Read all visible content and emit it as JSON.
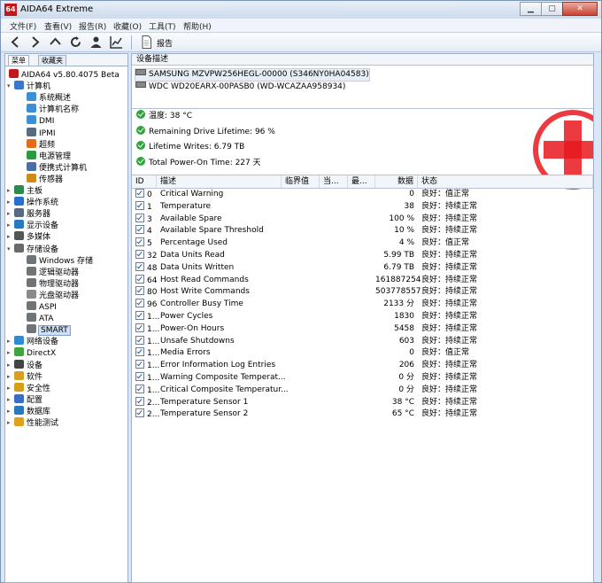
{
  "window": {
    "title": "AIDA64 Extreme",
    "app_icon_text": "64",
    "buttons": {
      "minimize": "▁",
      "maximize": "▢",
      "close": "✕"
    }
  },
  "menu": [
    "文件(F)",
    "查看(V)",
    "报告(R)",
    "收藏(O)",
    "工具(T)",
    "帮助(H)"
  ],
  "toolbar": {
    "icons": [
      "back-icon",
      "forward-icon",
      "up-icon",
      "refresh-icon",
      "user-icon",
      "chart-icon"
    ],
    "report_label": "报告"
  },
  "left_tabs": [
    "菜单",
    "收藏夹"
  ],
  "tree": [
    {
      "label": "AIDA64 v5.80.4075 Beta",
      "level": 0,
      "icon": "aida-icon",
      "expander": ""
    },
    {
      "label": "计算机",
      "level": 1,
      "icon": "computer-icon",
      "expander": "▾"
    },
    {
      "label": "系统概述",
      "level": 2,
      "icon": "monitor-icon",
      "expander": ""
    },
    {
      "label": "计算机名称",
      "level": 2,
      "icon": "monitor-icon",
      "expander": ""
    },
    {
      "label": "DMI",
      "level": 2,
      "icon": "monitor-icon",
      "expander": ""
    },
    {
      "label": "IPMI",
      "level": 2,
      "icon": "server-icon",
      "expander": ""
    },
    {
      "label": "超频",
      "level": 2,
      "icon": "flame-icon",
      "expander": ""
    },
    {
      "label": "电源管理",
      "level": 2,
      "icon": "power-icon",
      "expander": ""
    },
    {
      "label": "便携式计算机",
      "level": 2,
      "icon": "laptop-icon",
      "expander": ""
    },
    {
      "label": "传感器",
      "level": 2,
      "icon": "gauge-icon",
      "expander": ""
    },
    {
      "label": "主板",
      "level": 1,
      "icon": "motherboard-icon",
      "expander": "▸"
    },
    {
      "label": "操作系统",
      "level": 1,
      "icon": "windows-icon",
      "expander": "▸"
    },
    {
      "label": "服务器",
      "level": 1,
      "icon": "server-icon",
      "expander": "▸"
    },
    {
      "label": "显示设备",
      "level": 1,
      "icon": "display-icon",
      "expander": "▸"
    },
    {
      "label": "多媒体",
      "level": 1,
      "icon": "speaker-icon",
      "expander": "▸"
    },
    {
      "label": "存储设备",
      "level": 1,
      "icon": "storage-icon",
      "expander": "▾"
    },
    {
      "label": "Windows 存储",
      "level": 2,
      "icon": "drive-icon",
      "expander": ""
    },
    {
      "label": "逻辑驱动器",
      "level": 2,
      "icon": "drive-icon",
      "expander": ""
    },
    {
      "label": "物理驱动器",
      "level": 2,
      "icon": "drive-icon",
      "expander": ""
    },
    {
      "label": "光盘驱动器",
      "level": 2,
      "icon": "optical-icon",
      "expander": ""
    },
    {
      "label": "ASPI",
      "level": 2,
      "icon": "drive-icon",
      "expander": ""
    },
    {
      "label": "ATA",
      "level": 2,
      "icon": "drive-icon",
      "expander": ""
    },
    {
      "label": "SMART",
      "level": 2,
      "icon": "drive-icon",
      "expander": "",
      "selected": true
    },
    {
      "label": "网络设备",
      "level": 1,
      "icon": "network-icon",
      "expander": "▸"
    },
    {
      "label": "DirectX",
      "level": 1,
      "icon": "xbox-icon",
      "expander": "▸"
    },
    {
      "label": "设备",
      "level": 1,
      "icon": "device-icon",
      "expander": "▸"
    },
    {
      "label": "软件",
      "level": 1,
      "icon": "software-icon",
      "expander": "▸"
    },
    {
      "label": "安全性",
      "level": 1,
      "icon": "shield-icon",
      "expander": "▸"
    },
    {
      "label": "配置",
      "level": 1,
      "icon": "config-icon",
      "expander": "▸"
    },
    {
      "label": "数据库",
      "level": 1,
      "icon": "database-icon",
      "expander": "▸"
    },
    {
      "label": "性能测试",
      "level": 1,
      "icon": "benchmark-icon",
      "expander": "▸"
    }
  ],
  "device_panel": {
    "header": "设备描述",
    "devices": [
      {
        "label": "SAMSUNG MZVPW256HEGL-00000 (S346NY0HA04583)",
        "selected": true
      },
      {
        "label": "WDC WD20EARX-00PASB0 (WD-WCAZAA958934)",
        "selected": false
      }
    ]
  },
  "summary": [
    "温度: 38 °C",
    "Remaining Drive Lifetime: 96 %",
    "Lifetime Writes: 6.79 TB",
    "Total Power-On Time: 227 天"
  ],
  "grid": {
    "columns": [
      "ID",
      "描述",
      "临界值",
      "当...",
      "最...",
      "数据",
      "状态"
    ],
    "rows": [
      [
        "0",
        "Critical Warning",
        "0",
        "良好：值正常"
      ],
      [
        "1",
        "Temperature",
        "38",
        "良好：持续正常"
      ],
      [
        "3",
        "Available Spare",
        "100 %",
        "良好：持续正常"
      ],
      [
        "4",
        "Available Spare Threshold",
        "10 %",
        "良好：持续正常"
      ],
      [
        "5",
        "Percentage Used",
        "4 %",
        "良好：值正常"
      ],
      [
        "32",
        "Data Units Read",
        "5.99 TB",
        "良好：持续正常"
      ],
      [
        "48",
        "Data Units Written",
        "6.79 TB",
        "良好：持续正常"
      ],
      [
        "64",
        "Host Read Commands",
        "161887254",
        "良好：持续正常"
      ],
      [
        "80",
        "Host Write Commands",
        "503778557",
        "良好：持续正常"
      ],
      [
        "96",
        "Controller Busy Time",
        "2133 分",
        "良好：持续正常"
      ],
      [
        "1...",
        "Power Cycles",
        "1830",
        "良好：持续正常"
      ],
      [
        "1...",
        "Power-On Hours",
        "5458",
        "良好：持续正常"
      ],
      [
        "1...",
        "Unsafe Shutdowns",
        "603",
        "良好：持续正常"
      ],
      [
        "1...",
        "Media Errors",
        "0",
        "良好：值正常"
      ],
      [
        "1...",
        "Error Information Log Entries",
        "206",
        "良好：持续正常"
      ],
      [
        "1...",
        "Warning Composite Temperat...",
        "0 分",
        "良好：持续正常"
      ],
      [
        "1...",
        "Critical Composite Temperatur...",
        "0 分",
        "良好：持续正常"
      ],
      [
        "2...",
        "Temperature Sensor 1",
        "38 °C",
        "良好：持续正常"
      ],
      [
        "2...",
        "Temperature Sensor 2",
        "65 °C",
        "良好：持续正常"
      ]
    ]
  },
  "colors": {
    "ok_green": "#2ea43b",
    "brand_red": "#c0181b",
    "selection": "#cde0f7"
  }
}
